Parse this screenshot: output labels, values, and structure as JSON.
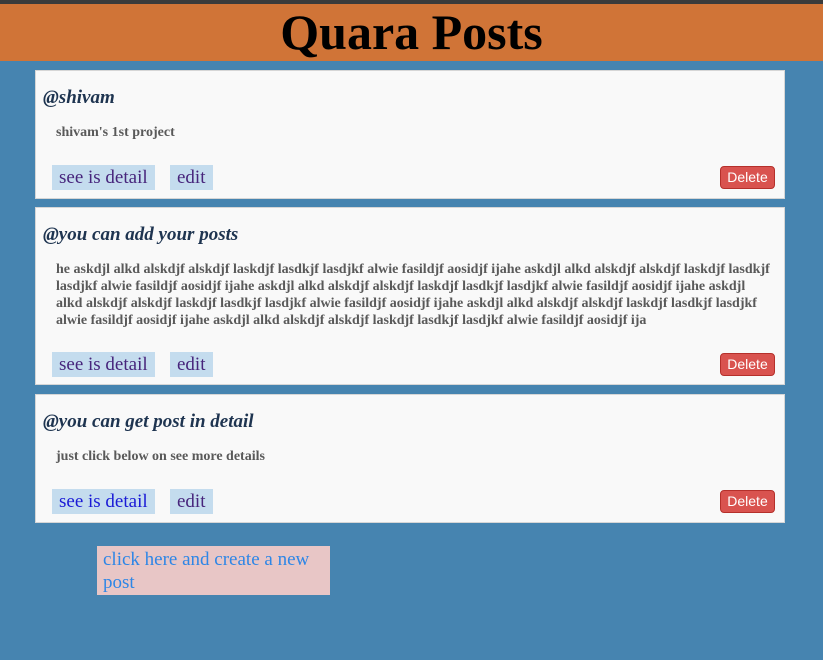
{
  "header": {
    "title": "Quara Posts"
  },
  "posts": [
    {
      "author": "@shivam",
      "content": "shivam's 1st project",
      "detail_label": "see is detail",
      "edit_label": "edit",
      "delete_label": "Delete"
    },
    {
      "author": "@you can add your posts",
      "content": "he askdjl alkd alskdjf alskdjf laskdjf lasdkjf lasdjkf alwie fasildjf aosidjf ijahe askdjl alkd alskdjf alskdjf laskdjf lasdkjf lasdjkf alwie fasildjf aosidjf ijahe askdjl alkd alskdjf alskdjf laskdjf lasdkjf lasdjkf alwie fasildjf aosidjf ijahe askdjl alkd alskdjf alskdjf laskdjf lasdkjf lasdjkf alwie fasildjf aosidjf ijahe askdjl alkd alskdjf alskdjf laskdjf lasdkjf lasdjkf alwie fasildjf aosidjf ijahe askdjl alkd alskdjf alskdjf laskdjf lasdkjf lasdjkf alwie fasildjf aosidjf ija",
      "detail_label": "see is detail",
      "edit_label": "edit",
      "delete_label": "Delete"
    },
    {
      "author": "@you can get post in detail",
      "content": "just click below on see more details",
      "detail_label": "see is detail",
      "edit_label": "edit",
      "delete_label": "Delete"
    }
  ],
  "create_link": {
    "label": "click here and create a new post"
  },
  "colors": {
    "page_bg": "#4684b0",
    "header_bg": "#d07437",
    "delete_bg": "#d9534f",
    "link_bg": "#c4dcee",
    "create_bg": "#e8c6c6"
  }
}
